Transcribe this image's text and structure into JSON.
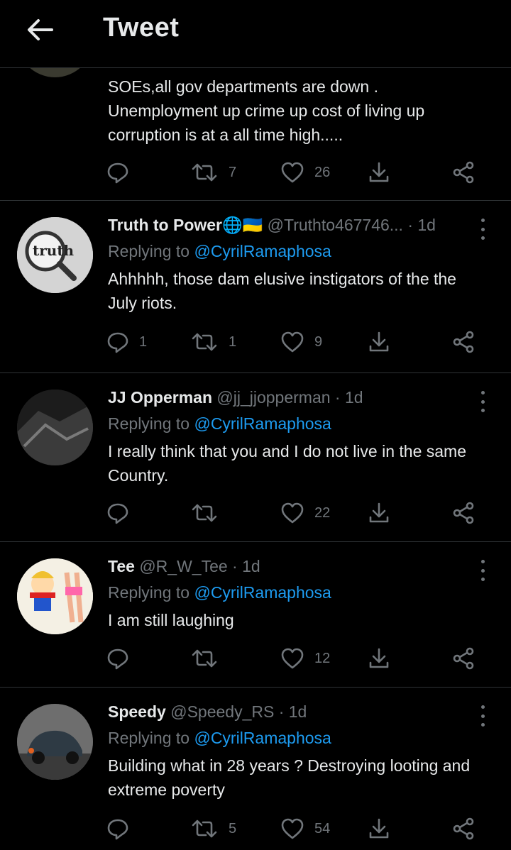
{
  "header": {
    "title": "Tweet",
    "back_icon": "arrow-left-icon"
  },
  "tweets": [
    {
      "body_lines": [
        "SOEs,all gov departments are down .",
        "Unemployment up  crime up cost of living up",
        "corruption is at a all time high....."
      ],
      "stats": {
        "replies": "",
        "retweets": "7",
        "likes": "26"
      }
    },
    {
      "name": "Truth to Power🌐🇺🇦",
      "meta": "@Truthto467746... · 1d",
      "replying_prefix": "Replying to",
      "mention": "@CyrilRamaphosa",
      "body": "Ahhhhh, those dam elusive instigators of the the July riots.",
      "stats": {
        "replies": "1",
        "retweets": "1",
        "likes": "9"
      }
    },
    {
      "name": "JJ Opperman",
      "meta": "@jj_jjopperman · 1d",
      "replying_prefix": "Replying to",
      "mention": "@CyrilRamaphosa",
      "body": "I really think that you and I do not live in the same Country.",
      "stats": {
        "replies": "",
        "retweets": "",
        "likes": "22"
      }
    },
    {
      "name": "Tee",
      "meta": "@R_W_Tee · 1d",
      "replying_prefix": "Replying to",
      "mention": "@CyrilRamaphosa",
      "body": "I am still laughing",
      "stats": {
        "replies": "",
        "retweets": "",
        "likes": "12"
      }
    },
    {
      "name": "Speedy",
      "meta": "@Speedy_RS · 1d",
      "replying_prefix": "Replying to",
      "mention": "@CyrilRamaphosa",
      "body": "Building what in 28 years ? Destroying looting and extreme poverty",
      "stats": {
        "replies": "",
        "retweets": "5",
        "likes": "54"
      }
    }
  ],
  "icons": [
    "reply-icon",
    "retweet-icon",
    "like-icon",
    "download-icon",
    "share-icon",
    "more-icon"
  ],
  "colors": {
    "background": "#000000",
    "text": "#e7e9ea",
    "muted": "#71767b",
    "link": "#1d9bf0",
    "divider": "#2f3336"
  }
}
